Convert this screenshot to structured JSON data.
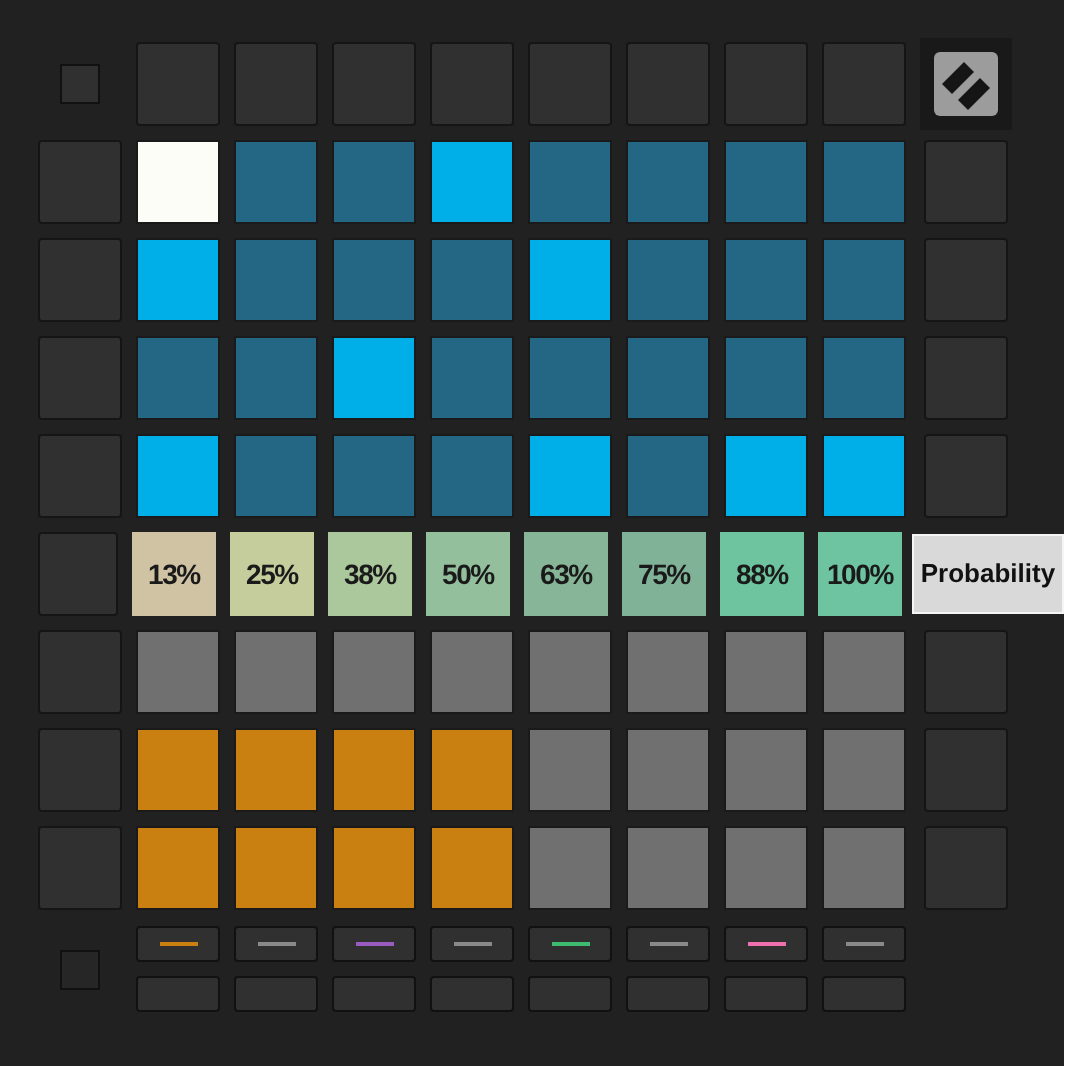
{
  "rows": [
    {
      "kind": "pads",
      "pads": [
        {
          "color": "#fdfdf8"
        },
        {
          "color": "#236785"
        },
        {
          "color": "#236785"
        },
        {
          "color": "#00aee8"
        },
        {
          "color": "#236785"
        },
        {
          "color": "#236785"
        },
        {
          "color": "#236785"
        },
        {
          "color": "#236785"
        }
      ]
    },
    {
      "kind": "pads",
      "pads": [
        {
          "color": "#00aee8"
        },
        {
          "color": "#236785"
        },
        {
          "color": "#236785"
        },
        {
          "color": "#236785"
        },
        {
          "color": "#00aee8"
        },
        {
          "color": "#236785"
        },
        {
          "color": "#236785"
        },
        {
          "color": "#236785"
        }
      ]
    },
    {
      "kind": "pads",
      "pads": [
        {
          "color": "#236785"
        },
        {
          "color": "#236785"
        },
        {
          "color": "#00aee8"
        },
        {
          "color": "#236785"
        },
        {
          "color": "#236785"
        },
        {
          "color": "#236785"
        },
        {
          "color": "#236785"
        },
        {
          "color": "#236785"
        }
      ]
    },
    {
      "kind": "pads",
      "pads": [
        {
          "color": "#00aee8"
        },
        {
          "color": "#236785"
        },
        {
          "color": "#236785"
        },
        {
          "color": "#236785"
        },
        {
          "color": "#00aee8"
        },
        {
          "color": "#236785"
        },
        {
          "color": "#00aee8"
        },
        {
          "color": "#00aee8"
        }
      ]
    },
    {
      "kind": "probability",
      "label": "Probability",
      "pads": [
        {
          "label": "13%",
          "color": "#cfc3a4"
        },
        {
          "label": "25%",
          "color": "#c6cd9c"
        },
        {
          "label": "38%",
          "color": "#abc79c"
        },
        {
          "label": "50%",
          "color": "#93bf9c"
        },
        {
          "label": "63%",
          "color": "#86b598"
        },
        {
          "label": "75%",
          "color": "#80b297"
        },
        {
          "label": "88%",
          "color": "#6fc4a0"
        },
        {
          "label": "100%",
          "color": "#6ec4a0"
        }
      ]
    },
    {
      "kind": "pads",
      "pads": [
        {
          "color": "#707070"
        },
        {
          "color": "#707070"
        },
        {
          "color": "#707070"
        },
        {
          "color": "#707070"
        },
        {
          "color": "#707070"
        },
        {
          "color": "#707070"
        },
        {
          "color": "#707070"
        },
        {
          "color": "#707070"
        }
      ]
    },
    {
      "kind": "pads",
      "pads": [
        {
          "color": "#c98010"
        },
        {
          "color": "#c98010"
        },
        {
          "color": "#c98010"
        },
        {
          "color": "#c98010"
        },
        {
          "color": "#707070"
        },
        {
          "color": "#707070"
        },
        {
          "color": "#707070"
        },
        {
          "color": "#707070"
        }
      ]
    },
    {
      "kind": "pads",
      "pads": [
        {
          "color": "#c98010"
        },
        {
          "color": "#c98010"
        },
        {
          "color": "#c98010"
        },
        {
          "color": "#c98010"
        },
        {
          "color": "#707070"
        },
        {
          "color": "#707070"
        },
        {
          "color": "#707070"
        },
        {
          "color": "#707070"
        }
      ]
    }
  ],
  "track_strips": [
    {
      "color": "#c98010"
    },
    {
      "color": "#8a8a8a"
    },
    {
      "color": "#9a5bc0"
    },
    {
      "color": "#8a8a8a"
    },
    {
      "color": "#3dbb6e"
    },
    {
      "color": "#8a8a8a"
    },
    {
      "color": "#f06fae"
    },
    {
      "color": "#8a8a8a"
    }
  ]
}
